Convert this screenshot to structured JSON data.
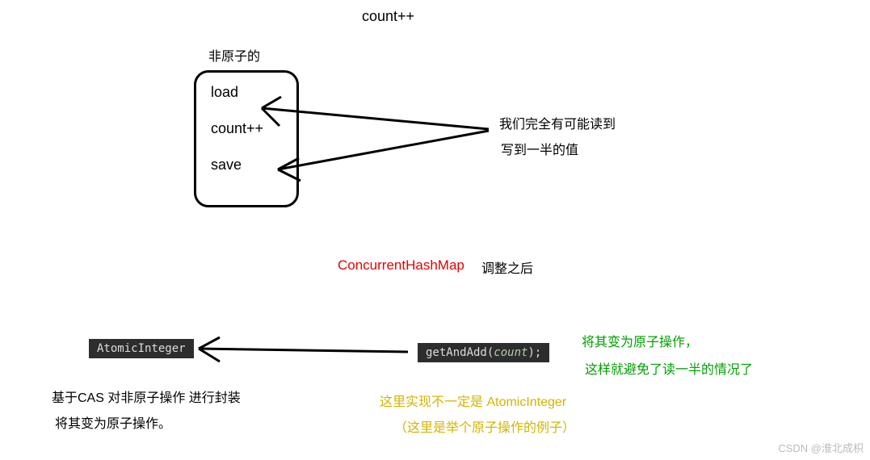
{
  "top": {
    "title": "count++",
    "nonatomic_label": "非原子的",
    "box": {
      "line1": "load",
      "line2": "count++",
      "line3": "save"
    },
    "note_line1": "我们完全有可能读到",
    "note_line2": "写到一半的值"
  },
  "middle": {
    "red_label": "ConcurrentHashMap",
    "after_label": "调整之后"
  },
  "bottom": {
    "atomic_badge": "AtomicInteger",
    "code_method": "getAndAdd",
    "code_open": "(",
    "code_arg": "count",
    "code_close": ");",
    "green_line1": "将其变为原子操作，",
    "green_line2": "这样就避免了读一半的情况了",
    "explain_line1": "基于CAS 对非原子操作 进行封装",
    "explain_line2": "将其变为原子操作。",
    "gold_line1": "这里实现不一定是 AtomicInteger",
    "gold_line2": "（这里是举个原子操作的例子）"
  },
  "watermark": "CSDN @淮北成枳"
}
